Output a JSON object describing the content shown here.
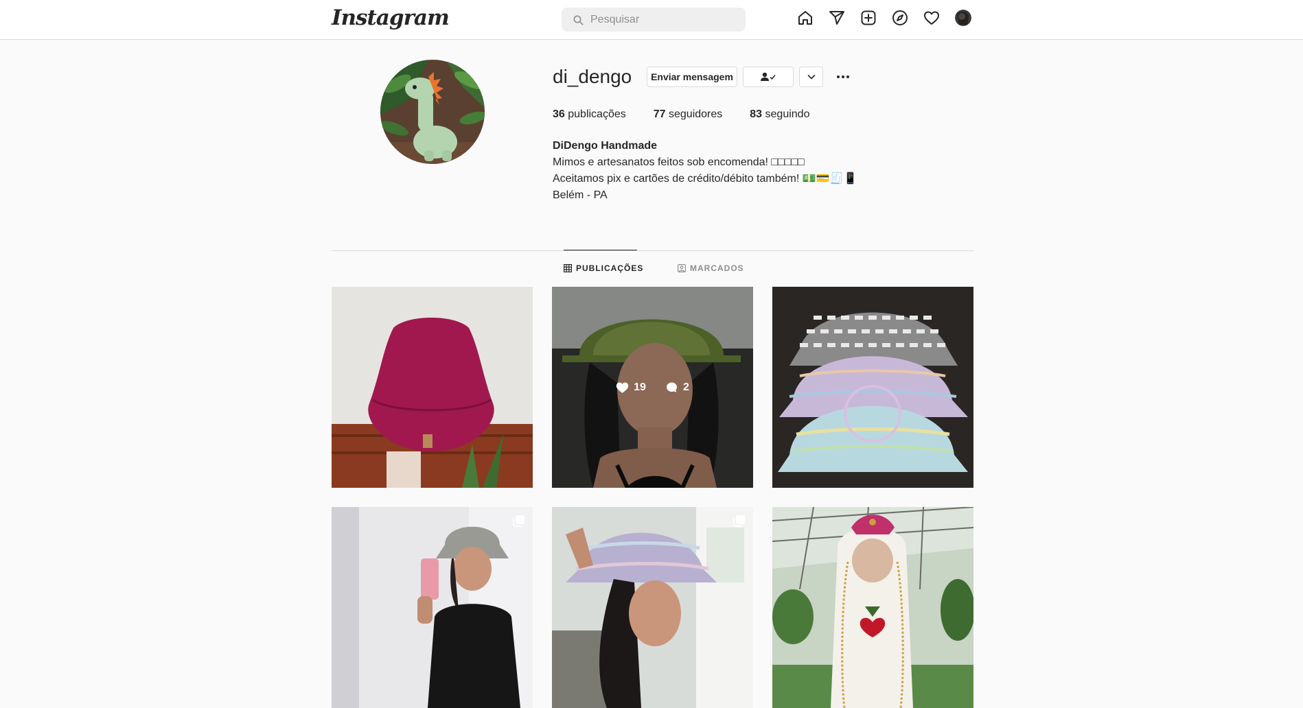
{
  "nav": {
    "logo": "Instagram",
    "search_placeholder": "Pesquisar",
    "icons": [
      "home-icon",
      "direct-icon",
      "new-post-icon",
      "explore-icon",
      "activity-icon",
      "profile-avatar"
    ]
  },
  "profile": {
    "username": "di_dengo",
    "buttons": {
      "message": "Enviar mensagem",
      "following_icon": "person-check-icon",
      "more_icon": "chevron-down-icon",
      "options_icon": "more-dots-icon"
    },
    "stats": {
      "posts_count": "36",
      "posts_label": "publicações",
      "followers_count": "77",
      "followers_label": "seguidores",
      "following_count": "83",
      "following_label": "seguindo"
    },
    "bio": {
      "full_name": "DiDengo Handmade",
      "line1": "Mimos e artesanatos feitos sob encomenda! □□□□□",
      "line2": "Aceitamos pix e cartões de crédito/débito também! 💵💳🧾📱",
      "line3": "Belém - PA"
    }
  },
  "tabs": [
    {
      "label": "PUBLICAÇÕES",
      "icon": "grid-icon",
      "active": true
    },
    {
      "label": "MARCADOS",
      "icon": "tagged-icon",
      "active": false
    }
  ],
  "posts": [
    {
      "subject": "magenta-bucket-hat",
      "multi": false
    },
    {
      "subject": "woman-green-hat",
      "multi": false,
      "likes": "19",
      "comments": "2"
    },
    {
      "subject": "three-bucket-hats",
      "multi": false
    },
    {
      "subject": "mirror-selfie-hat",
      "multi": true
    },
    {
      "subject": "pastel-hat-profile",
      "multi": true
    },
    {
      "subject": "amigurumi-doll",
      "multi": false
    }
  ],
  "colors": {
    "border": "#dbdbdb",
    "text": "#262626",
    "muted": "#8e8e8e",
    "background": "#fafafa"
  }
}
